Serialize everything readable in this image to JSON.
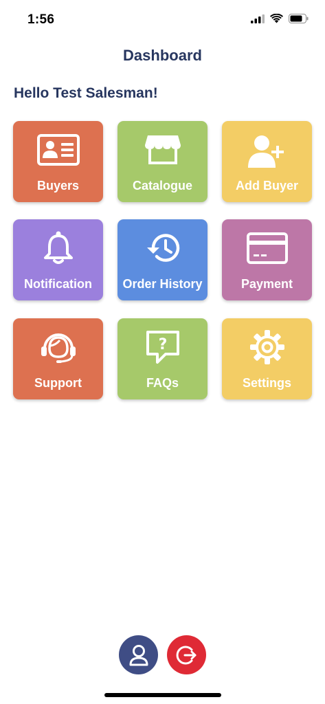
{
  "status_bar": {
    "time": "1:56",
    "icons": [
      "signal-icon",
      "wifi-icon",
      "battery-icon"
    ]
  },
  "header": {
    "title": "Dashboard"
  },
  "greeting": "Hello Test Salesman!",
  "tiles": [
    {
      "label": "Buyers",
      "icon": "id-card-icon",
      "color": "#dd7150"
    },
    {
      "label": "Catalogue",
      "icon": "store-icon",
      "color": "#a6c96a"
    },
    {
      "label": "Add Buyer",
      "icon": "add-user-icon",
      "color": "#f3cd65"
    },
    {
      "label": "Notification",
      "icon": "bell-icon",
      "color": "#9b80dd"
    },
    {
      "label": "Order History",
      "icon": "history-icon",
      "color": "#5c8ddf"
    },
    {
      "label": "Payment",
      "icon": "credit-card-icon",
      "color": "#bd77a7"
    },
    {
      "label": "Support",
      "icon": "headset-icon",
      "color": "#dd7150"
    },
    {
      "label": "FAQs",
      "icon": "question-bubble-icon",
      "color": "#a6c96a"
    },
    {
      "label": "Settings",
      "icon": "gear-icon",
      "color": "#f3cd65"
    }
  ],
  "bottom_bar": {
    "profile": {
      "icon": "user-icon",
      "color": "#3f4d85"
    },
    "logout": {
      "icon": "logout-icon",
      "color": "#df2a35"
    }
  }
}
